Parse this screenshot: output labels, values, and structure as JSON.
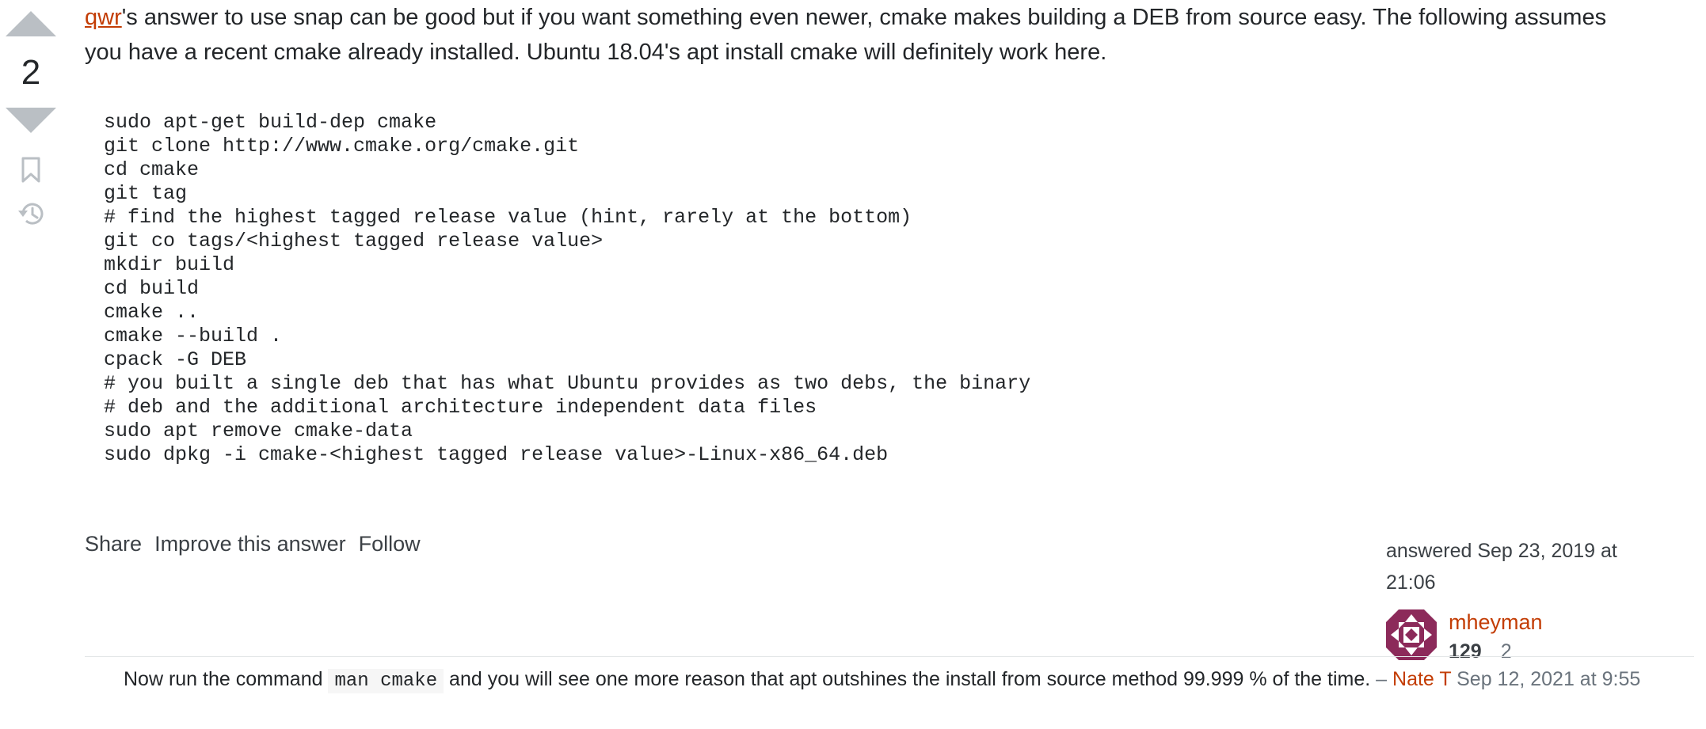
{
  "vote": {
    "count": "2"
  },
  "answer": {
    "link_text": "qwr",
    "line1_rest": "'s answer to use snap can be good but if you want something even newer, cmake makes building a DEB from source easy. The following assumes",
    "line2": "you have a recent cmake already installed. Ubuntu 18.04's apt install cmake will definitely work here.",
    "code": "sudo apt-get build-dep cmake\ngit clone http://www.cmake.org/cmake.git\ncd cmake\ngit tag\n# find the highest tagged release value (hint, rarely at the bottom)\ngit co tags/<highest tagged release value>\nmkdir build\ncd build\ncmake ..\ncmake --build .\ncpack -G DEB\n# you built a single deb that has what Ubuntu provides as two debs, the binary\n# deb and the additional architecture independent data files\nsudo apt remove cmake-data\nsudo dpkg -i cmake-<highest tagged release value>-Linux-x86_64.deb"
  },
  "actions": {
    "share": "Share",
    "improve": "Improve this answer",
    "follow": "Follow"
  },
  "user_card": {
    "answered": "answered Sep 23, 2019 at 21:06",
    "name": "mheyman",
    "reputation": "129",
    "badges": "2"
  },
  "comment": {
    "text_before": "Now run the command",
    "code": "man cmake",
    "text_after": "and you will see one more reason that apt outshines the install from source method 99.999 % of the time.",
    "separator": "–",
    "user": "Nate T",
    "date": "Sep 12, 2021 at 9:55"
  },
  "colors": {
    "link": "#c33d05",
    "vote_arrow": "#babfc4",
    "avatar": "#8c2a5a"
  },
  "icons": {
    "bookmark": "bookmark-icon",
    "history": "history-icon"
  }
}
